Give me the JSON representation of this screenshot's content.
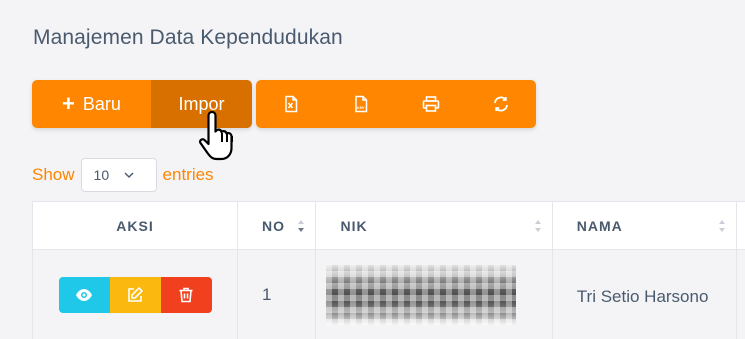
{
  "page": {
    "title": "Manajemen Data Kependudukan"
  },
  "toolbar": {
    "new_label": "Baru",
    "new_icon": "plus-icon",
    "import_label": "Impor",
    "export_buttons": [
      {
        "icon": "excel-file-icon"
      },
      {
        "icon": "csv-file-icon"
      },
      {
        "icon": "printer-icon"
      },
      {
        "icon": "refresh-icon"
      }
    ]
  },
  "length_menu": {
    "prefix": "Show",
    "selected": "10",
    "suffix": "entries"
  },
  "table": {
    "columns": [
      "AKSI",
      "NO",
      "NIK",
      "NAMA"
    ],
    "rows": [
      {
        "no": "1",
        "nik": "",
        "nama": "Tri Setio Harsono"
      }
    ]
  },
  "colors": {
    "primary": "#fe8600",
    "primary_active": "#d87000",
    "view": "#1fc8e8",
    "edit": "#fbb80f",
    "delete": "#f0401e",
    "text": "#4a5a6e"
  }
}
